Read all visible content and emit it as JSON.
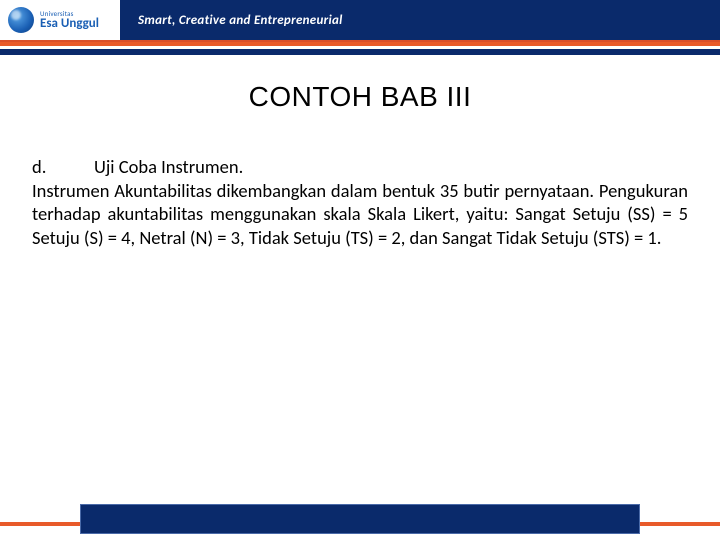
{
  "header": {
    "logo_small": "Universitas",
    "logo_big": "Esa Unggul",
    "tagline": "Smart, Creative and Entrepreneurial"
  },
  "title": "CONTOH BAB III",
  "body": {
    "item_label": "d.",
    "item_heading": "Uji Coba Instrumen.",
    "paragraph": "Instrumen Akuntabilitas dikembangkan dalam bentuk 35 butir pernyataan. Pengukuran terhadap akuntabilitas menggunakan skala Skala Likert, yaitu: Sangat Setuju (SS) = 5 Setuju (S) = 4, Netral   (N) = 3,  Tidak Setuju (TS) = 2, dan Sangat Tidak Setuju (STS) = 1."
  }
}
